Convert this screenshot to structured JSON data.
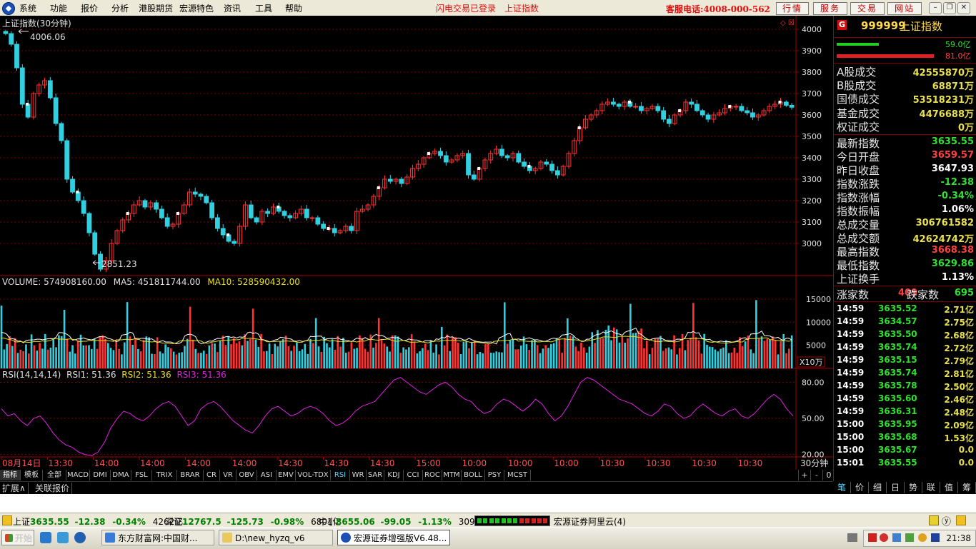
{
  "menu": {
    "items": [
      "系统",
      "功能",
      "报价",
      "分析",
      "港股期货",
      "宏源特色",
      "资讯",
      "工具",
      "帮助"
    ],
    "status1": "闪电交易已登录",
    "status2": "上证指数",
    "service": "客服电话:4008-000-562",
    "buttons": [
      "行情",
      "服务",
      "交易",
      "网站"
    ]
  },
  "chart": {
    "title": "上证指数(30分钟)",
    "high_label": "4006.06",
    "low_label": "2851.23",
    "volume_header": {
      "volume": "VOLUME: 574908160.00",
      "ma5": "MA5: 451811744.00",
      "ma10": "MA10: 528590432.00"
    },
    "rsi_header": {
      "title": "RSI(14,14,14)",
      "rsi1": "RSI1: 51.36",
      "rsi2": "RSI2: 51.36",
      "rsi3": "RSI3: 51.36"
    },
    "vol_unit": "X10万",
    "period": "30分钟",
    "price_ticks": [
      "4000",
      "3900",
      "3800",
      "3700",
      "3600",
      "3500",
      "3400",
      "3300",
      "3200",
      "3100",
      "3000"
    ],
    "vol_ticks": [
      "15000",
      "10000",
      "5000"
    ],
    "rsi_ticks": [
      "80.00",
      "50.00",
      "20.00"
    ],
    "time_labels": [
      "08月14日",
      "13:30",
      "14:00",
      "14:00",
      "14:00",
      "14:00",
      "14:30",
      "14:30",
      "14:30",
      "15:00",
      "10:00",
      "10:00",
      "10:00",
      "10:30",
      "10:30",
      "10:30",
      "10:30"
    ]
  },
  "chart_data": [
    {
      "type": "candlestick",
      "title": "上证指数(30分钟)",
      "ylim": [
        2850,
        4050
      ],
      "high": 4006.06,
      "low": 2851.23,
      "close_path": [
        3980,
        3930,
        3820,
        3650,
        3590,
        3700,
        3740,
        3760,
        3680,
        3560,
        3480,
        3300,
        3240,
        3200,
        3140,
        3050,
        2950,
        2880,
        2920,
        3000,
        3060,
        3110,
        3140,
        3180,
        3200,
        3170,
        3190,
        3160,
        3120,
        3080,
        3090,
        3140,
        3180,
        3240,
        3230,
        3220,
        3190,
        3120,
        3070,
        3040,
        3010,
        3000,
        3080,
        3180,
        3120,
        3100,
        3150,
        3140,
        3170,
        3150,
        3130,
        3120,
        3140,
        3160,
        3120,
        3120,
        3090,
        3070,
        3070,
        3050,
        3060,
        3080,
        3060,
        3150,
        3160,
        3180,
        3220,
        3260,
        3300,
        3290,
        3300,
        3280,
        3310,
        3350,
        3370,
        3400,
        3420,
        3430,
        3410,
        3380,
        3390,
        3410,
        3420,
        3320,
        3300,
        3350,
        3390,
        3420,
        3440,
        3410,
        3400,
        3420,
        3380,
        3360,
        3340,
        3350,
        3380,
        3370,
        3340,
        3320,
        3360,
        3420,
        3480,
        3540,
        3580,
        3600,
        3620,
        3650,
        3660,
        3650,
        3640,
        3660,
        3640,
        3640,
        3620,
        3630,
        3640,
        3620,
        3580,
        3560,
        3600,
        3620,
        3660,
        3650,
        3620,
        3600,
        3580,
        3600,
        3610,
        3630,
        3640,
        3640,
        3620,
        3610,
        3590,
        3600,
        3620,
        3640,
        3650,
        3660,
        3645,
        3636
      ]
    },
    {
      "type": "bar",
      "title": "VOLUME",
      "ylim": [
        0,
        17000
      ],
      "unit": "X10万",
      "series": [
        {
          "name": "VOLUME"
        },
        {
          "name": "MA5"
        },
        {
          "name": "MA10"
        }
      ]
    },
    {
      "type": "line",
      "title": "RSI(14,14,14)",
      "ylim": [
        18,
        88
      ],
      "series": [
        {
          "name": "RSI1",
          "values": [
            58,
            52,
            54,
            48,
            44,
            50,
            52,
            46,
            38,
            32,
            28,
            26,
            22,
            20,
            19,
            22,
            30,
            42,
            50,
            56,
            54,
            50,
            48,
            52,
            58,
            62,
            64,
            60,
            52,
            44,
            48,
            58,
            62,
            64,
            60,
            54,
            48,
            44,
            40,
            38,
            44,
            52,
            58,
            60,
            56,
            52,
            54,
            58,
            60,
            58,
            54,
            48,
            44,
            46,
            50,
            56,
            60,
            62,
            64,
            70,
            76,
            82,
            84,
            80,
            76,
            72,
            70,
            74,
            78,
            80,
            76,
            70,
            66,
            64,
            58,
            54,
            56,
            62,
            66,
            64,
            60,
            56,
            60,
            66,
            62,
            54,
            48,
            52,
            60,
            70,
            80,
            84,
            82,
            78,
            74,
            70,
            66,
            64,
            62,
            58,
            54,
            52,
            56,
            62,
            60,
            54,
            50,
            52,
            58,
            62,
            58,
            54,
            52,
            56,
            58,
            52,
            50,
            54,
            60,
            66,
            70,
            66,
            58,
            52
          ]
        }
      ]
    }
  ],
  "indicator_tabs": [
    "指标",
    "模板",
    "全部",
    "MACD",
    "DMI",
    "DMA",
    "FSL",
    "TRIX",
    "BRAR",
    "CR",
    "VR",
    "OBV",
    "ASI",
    "EMV",
    "VOL-TDX",
    "RSI",
    "WR",
    "SAR",
    "KDJ",
    "CCI",
    "ROC",
    "MTM",
    "BOLL",
    "PSY",
    "MCST"
  ],
  "tab_controls": [
    "+",
    "-",
    "0"
  ],
  "subtabs": [
    "扩展∧",
    "关联报价"
  ],
  "panel": {
    "gicon": "G",
    "code": "999999",
    "name": "上证指数",
    "bar_green": "59.0亿",
    "bar_red": "81.0亿",
    "green_ratio": 0.42,
    "stats1": [
      {
        "k": "A股成交",
        "v": "42555870万"
      },
      {
        "k": "B股成交",
        "v": "68871万"
      },
      {
        "k": "国债成交",
        "v": "53518231万"
      },
      {
        "k": "基金成交",
        "v": "4476688万"
      },
      {
        "k": "权证成交",
        "v": "0万"
      }
    ],
    "stats2": [
      {
        "k": "最新指数",
        "v": "3635.55",
        "c": "grn"
      },
      {
        "k": "今日开盘",
        "v": "3659.57",
        "c": "red"
      },
      {
        "k": "昨日收盘",
        "v": "3647.93",
        "c": "wht"
      },
      {
        "k": "指数涨跌",
        "v": "-12.38",
        "c": "grn"
      },
      {
        "k": "指数涨幅",
        "v": "-0.34%",
        "c": "grn"
      },
      {
        "k": "指数振幅",
        "v": "1.06%",
        "c": "wht"
      },
      {
        "k": "总成交量",
        "v": "306761582",
        "c": "yel"
      },
      {
        "k": "总成交额",
        "v": "42624742万",
        "c": "yel"
      },
      {
        "k": "最高指数",
        "v": "3668.38",
        "c": "red"
      },
      {
        "k": "最低指数",
        "v": "3629.86",
        "c": "grn"
      },
      {
        "k": "上证换手",
        "v": "1.13%",
        "c": "wht"
      }
    ],
    "updown": {
      "up_label": "涨家数",
      "up": "409",
      "down_label": "跌家数",
      "down": "695"
    },
    "ticks": [
      {
        "t": "14:59",
        "p": "3635.52",
        "v": "2.71亿"
      },
      {
        "t": "14:59",
        "p": "3634.57",
        "v": "2.75亿"
      },
      {
        "t": "14:59",
        "p": "3635.50",
        "v": "2.68亿"
      },
      {
        "t": "14:59",
        "p": "3635.74",
        "v": "2.72亿"
      },
      {
        "t": "14:59",
        "p": "3635.15",
        "v": "2.79亿"
      },
      {
        "t": "14:59",
        "p": "3635.74",
        "v": "2.81亿"
      },
      {
        "t": "14:59",
        "p": "3635.78",
        "v": "2.50亿"
      },
      {
        "t": "14:59",
        "p": "3635.60",
        "v": "2.46亿"
      },
      {
        "t": "14:59",
        "p": "3636.31",
        "v": "2.48亿"
      },
      {
        "t": "15:00",
        "p": "3635.95",
        "v": "2.09亿"
      },
      {
        "t": "15:00",
        "p": "3635.68",
        "v": "1.53亿"
      },
      {
        "t": "15:00",
        "p": "3635.67",
        "v": "0.0"
      },
      {
        "t": "15:01",
        "p": "3635.55",
        "v": "0.0"
      }
    ],
    "bottom_tabs": [
      "笔",
      "价",
      "细",
      "日",
      "势",
      "联",
      "值",
      "筹"
    ]
  },
  "statusbar": {
    "sh_label": "上证",
    "sh_price": "3635.55",
    "sh_chg": "-12.38",
    "sh_pct": "-0.34%",
    "sh_amt": "4262亿",
    "sz_label": "深证",
    "sz_price": "12767.5",
    "sz_chg": "-125.73",
    "sz_pct": "-0.98%",
    "sz_amt": "6801亿",
    "zx_label": "中小",
    "zx_price": "8655.06",
    "zx_chg": "-99.05",
    "zx_pct": "-1.13%",
    "zx_amt": "3093亿",
    "broker": "宏源证券阿里云(4)"
  },
  "taskbar": {
    "start": "开始",
    "tasks": [
      "东方财富网:中国财...",
      "D:\\new_hyzq_v6",
      "宏源证券增强版V6.48..."
    ],
    "clock": "21:38"
  },
  "colors": {
    "up": "#ff3333",
    "down": "#30d0e0",
    "grid": "#800000",
    "rsi": "#e020e0",
    "ma5": "#ffffff",
    "ma10": "#e8e020"
  }
}
